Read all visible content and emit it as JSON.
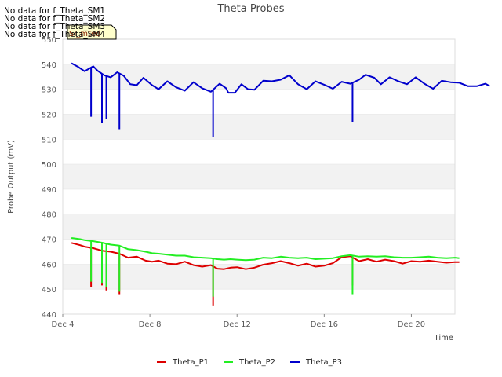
{
  "nodata_messages": [
    "No data for f_Theta_SM1",
    "No data for f_Theta_SM2",
    "No data for f_Theta_SM3",
    "No data for f_Theta_SM4"
  ],
  "summary_box_label": "SI_mted",
  "chart_data": {
    "type": "line",
    "title": "Theta Probes",
    "xlabel": "Time",
    "ylabel": "Probe Output (mV)",
    "x_ticks": [
      "Dec 4",
      "Dec 8",
      "Dec 12",
      "Dec 16",
      "Dec 20"
    ],
    "x_tick_days": [
      4,
      8,
      12,
      16,
      20
    ],
    "xlim_days": [
      4,
      22
    ],
    "ylim": [
      440,
      550
    ],
    "y_ticks": [
      440,
      450,
      460,
      470,
      480,
      490,
      500,
      510,
      520,
      530,
      540,
      550
    ],
    "grid": "horizontal bands",
    "legend_position": "bottom",
    "series": [
      {
        "name": "Theta_P1",
        "color": "#dd0000",
        "points": [
          [
            4.4,
            468.5
          ],
          [
            4.8,
            467.6
          ],
          [
            5.0,
            467.0
          ],
          [
            5.4,
            466.4
          ],
          [
            5.8,
            465.4
          ],
          [
            6.2,
            465.0
          ],
          [
            6.6,
            464.2
          ],
          [
            7.0,
            462.6
          ],
          [
            7.4,
            463.0
          ],
          [
            7.8,
            461.4
          ],
          [
            8.1,
            461.0
          ],
          [
            8.4,
            461.4
          ],
          [
            8.8,
            460.2
          ],
          [
            9.2,
            460.0
          ],
          [
            9.6,
            461.0
          ],
          [
            10.0,
            459.6
          ],
          [
            10.4,
            459.0
          ],
          [
            10.8,
            459.6
          ],
          [
            11.1,
            458.2
          ],
          [
            11.4,
            458.0
          ],
          [
            11.7,
            458.6
          ],
          [
            12.0,
            458.8
          ],
          [
            12.4,
            458.0
          ],
          [
            12.8,
            458.6
          ],
          [
            13.2,
            459.8
          ],
          [
            13.6,
            460.4
          ],
          [
            14.0,
            461.2
          ],
          [
            14.4,
            460.4
          ],
          [
            14.8,
            459.4
          ],
          [
            15.2,
            460.2
          ],
          [
            15.6,
            459.0
          ],
          [
            16.0,
            459.4
          ],
          [
            16.4,
            460.4
          ],
          [
            16.8,
            462.8
          ],
          [
            17.2,
            463.2
          ],
          [
            17.6,
            461.2
          ],
          [
            18.0,
            462.0
          ],
          [
            18.4,
            461.0
          ],
          [
            18.8,
            461.8
          ],
          [
            19.2,
            461.2
          ],
          [
            19.6,
            460.2
          ],
          [
            20.0,
            461.2
          ],
          [
            20.4,
            461.0
          ],
          [
            20.8,
            461.4
          ],
          [
            21.2,
            461.0
          ],
          [
            21.6,
            460.6
          ],
          [
            22.0,
            460.8
          ],
          [
            22.2,
            460.8
          ]
        ],
        "dips": [
          [
            5.3,
            451.0
          ],
          [
            5.8,
            451.5
          ],
          [
            6.0,
            449.5
          ],
          [
            6.6,
            448.0
          ],
          [
            10.9,
            443.5
          ],
          [
            17.3,
            451.5
          ]
        ]
      },
      {
        "name": "Theta_P2",
        "color": "#22ee22",
        "points": [
          [
            4.4,
            470.5
          ],
          [
            4.8,
            470.0
          ],
          [
            5.0,
            469.6
          ],
          [
            5.4,
            469.2
          ],
          [
            5.8,
            468.6
          ],
          [
            6.2,
            467.8
          ],
          [
            6.6,
            467.4
          ],
          [
            7.0,
            466.0
          ],
          [
            7.4,
            465.6
          ],
          [
            7.8,
            465.0
          ],
          [
            8.1,
            464.4
          ],
          [
            8.4,
            464.2
          ],
          [
            8.8,
            463.8
          ],
          [
            9.2,
            463.4
          ],
          [
            9.6,
            463.4
          ],
          [
            10.0,
            462.8
          ],
          [
            10.4,
            462.6
          ],
          [
            10.8,
            462.4
          ],
          [
            11.1,
            462.0
          ],
          [
            11.4,
            461.8
          ],
          [
            11.7,
            462.0
          ],
          [
            12.0,
            461.8
          ],
          [
            12.4,
            461.6
          ],
          [
            12.8,
            461.8
          ],
          [
            13.2,
            462.6
          ],
          [
            13.6,
            462.4
          ],
          [
            14.0,
            463.0
          ],
          [
            14.4,
            462.6
          ],
          [
            14.8,
            462.4
          ],
          [
            15.2,
            462.6
          ],
          [
            15.6,
            462.0
          ],
          [
            16.0,
            462.2
          ],
          [
            16.4,
            462.4
          ],
          [
            16.8,
            463.2
          ],
          [
            17.2,
            463.6
          ],
          [
            17.6,
            463.0
          ],
          [
            18.0,
            463.2
          ],
          [
            18.4,
            463.0
          ],
          [
            18.8,
            463.2
          ],
          [
            19.2,
            462.8
          ],
          [
            19.6,
            462.6
          ],
          [
            20.0,
            462.6
          ],
          [
            20.4,
            462.8
          ],
          [
            20.8,
            463.0
          ],
          [
            21.2,
            462.6
          ],
          [
            21.6,
            462.4
          ],
          [
            22.0,
            462.6
          ],
          [
            22.2,
            462.4
          ]
        ],
        "dips": [
          [
            5.3,
            453.0
          ],
          [
            5.8,
            452.5
          ],
          [
            6.0,
            451.0
          ],
          [
            6.6,
            449.0
          ],
          [
            10.9,
            447.0
          ],
          [
            17.3,
            448.0
          ]
        ]
      },
      {
        "name": "Theta_P3",
        "color": "#0000cc",
        "points": [
          [
            4.4,
            540.4
          ],
          [
            4.7,
            539.0
          ],
          [
            5.0,
            537.2
          ],
          [
            5.4,
            539.2
          ],
          [
            5.6,
            537.4
          ],
          [
            5.9,
            535.6
          ],
          [
            6.2,
            534.8
          ],
          [
            6.5,
            536.8
          ],
          [
            6.8,
            535.4
          ],
          [
            7.1,
            532.0
          ],
          [
            7.4,
            531.6
          ],
          [
            7.7,
            534.6
          ],
          [
            8.1,
            531.6
          ],
          [
            8.4,
            530.0
          ],
          [
            8.8,
            533.2
          ],
          [
            9.2,
            530.8
          ],
          [
            9.6,
            529.4
          ],
          [
            10.0,
            532.8
          ],
          [
            10.4,
            530.4
          ],
          [
            10.8,
            529.0
          ],
          [
            11.2,
            532.2
          ],
          [
            11.5,
            530.4
          ],
          [
            11.6,
            528.6
          ],
          [
            11.9,
            528.6
          ],
          [
            12.2,
            532.0
          ],
          [
            12.5,
            530.0
          ],
          [
            12.8,
            529.8
          ],
          [
            13.2,
            533.4
          ],
          [
            13.6,
            533.2
          ],
          [
            14.0,
            533.8
          ],
          [
            14.4,
            535.6
          ],
          [
            14.8,
            532.0
          ],
          [
            15.2,
            530.0
          ],
          [
            15.6,
            533.2
          ],
          [
            16.0,
            531.8
          ],
          [
            16.4,
            530.2
          ],
          [
            16.8,
            533.0
          ],
          [
            17.2,
            532.2
          ],
          [
            17.6,
            533.8
          ],
          [
            17.9,
            535.8
          ],
          [
            18.3,
            534.6
          ],
          [
            18.6,
            532.0
          ],
          [
            19.0,
            534.8
          ],
          [
            19.4,
            533.2
          ],
          [
            19.8,
            532.0
          ],
          [
            20.2,
            534.8
          ],
          [
            20.6,
            532.2
          ],
          [
            21.0,
            530.2
          ],
          [
            21.4,
            533.4
          ],
          [
            21.8,
            532.8
          ],
          [
            22.2,
            532.6
          ],
          [
            22.6,
            531.2
          ],
          [
            23.0,
            531.2
          ],
          [
            23.4,
            532.2
          ],
          [
            23.6,
            531.2
          ]
        ],
        "dips": [
          [
            5.3,
            519.0
          ],
          [
            5.8,
            516.5
          ],
          [
            6.0,
            518.0
          ],
          [
            6.6,
            514.0
          ],
          [
            10.9,
            511.0
          ],
          [
            17.3,
            517.0
          ]
        ]
      }
    ]
  }
}
